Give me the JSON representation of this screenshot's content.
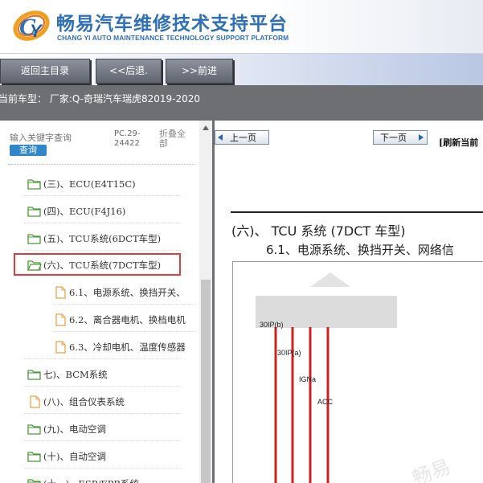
{
  "brand": {
    "title": "畅易汽车维修技术支持平台",
    "subtitle": "CHANG YI AUTO MAINTENANCE TECHNOLOGY SUPPORT PLATFORM",
    "logo_icon": "cy-logo-icon",
    "title_color": "#2f6fb4"
  },
  "nav": {
    "home": "返回主目录",
    "back": "<<后退.",
    "forward": ">>前进"
  },
  "status": {
    "text": "当前车型：  厂家:Q-奇瑞汽车瑞虎82019-2020"
  },
  "sidebar": {
    "search_placeholder": "输入关键字查询",
    "search_button": "查询",
    "pc_label": "PC.29-24422",
    "collapse_all": "折叠全部",
    "items": [
      {
        "label": "(三)、ECU(E4T15C)",
        "icon": "folder-open-icon"
      },
      {
        "label": "(四)、ECU(F4J16)",
        "icon": "folder-open-icon"
      },
      {
        "label": "(五)、TCU系统(6DCT车型)",
        "icon": "folder-open-icon"
      },
      {
        "label": "(六)、TCU系统(7DCT车型)",
        "icon": "folder-open-icon",
        "selected": true
      },
      {
        "label": "6.1、电源系统、换挡开关、",
        "icon": "document-icon"
      },
      {
        "label": "6.2、离合器电机、换档电机",
        "icon": "document-icon"
      },
      {
        "label": "6.3、冷却电机、温度传感器",
        "icon": "document-icon"
      },
      {
        "label": "七)、BCM系统",
        "icon": "folder-open-icon"
      },
      {
        "label": "(八)、组合仪表系统",
        "icon": "document-icon"
      },
      {
        "label": "(九)、电动空调",
        "icon": "folder-open-icon"
      },
      {
        "label": "(十)、自动空调",
        "icon": "folder-open-icon"
      },
      {
        "label": "(十一)、ESP/EPB系统",
        "icon": "folder-open-icon"
      }
    ],
    "accent_color": "#e23b3b"
  },
  "main": {
    "prev_page": "上一页",
    "next_page": "下一页",
    "refresh": "[刷新当前",
    "doc_title": "(六)、 TCU 系统 (7DCT 车型)",
    "doc_subtitle": "6.1、电源系统、换挡开关、网络信",
    "diagram_labels": [
      "30IP(b)",
      "30IP(a)",
      "IGNa",
      "ACC"
    ],
    "wire_color": "#cc2222",
    "watermark": "畅易"
  }
}
